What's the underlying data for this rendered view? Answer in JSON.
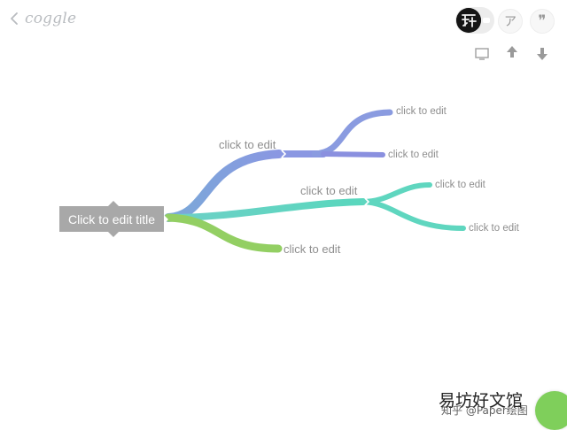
{
  "app": {
    "logo_text": "coggle"
  },
  "toolbar": {
    "collab_glyph": "ア",
    "comments_glyph": "❞"
  },
  "mindmap": {
    "root_label": "Click to edit title",
    "nodes": [
      {
        "id": "top-branch",
        "label": "click to edit"
      },
      {
        "id": "top-branch-child-1",
        "label": "click to edit"
      },
      {
        "id": "top-branch-child-2",
        "label": "click to edit"
      },
      {
        "id": "mid-branch",
        "label": "click to edit"
      },
      {
        "id": "mid-branch-child-1",
        "label": "click to edit"
      },
      {
        "id": "mid-branch-child-2",
        "label": "click to edit"
      },
      {
        "id": "low-branch",
        "label": "click to edit"
      }
    ],
    "colors": {
      "blue": "#7f9be0",
      "teal": "#5fd6bf",
      "green": "#93cf63",
      "node": "#a8a8a8"
    }
  },
  "watermark": {
    "main_text": "易坊好文馆",
    "sub_text": "知乎 @Paper绘图"
  }
}
